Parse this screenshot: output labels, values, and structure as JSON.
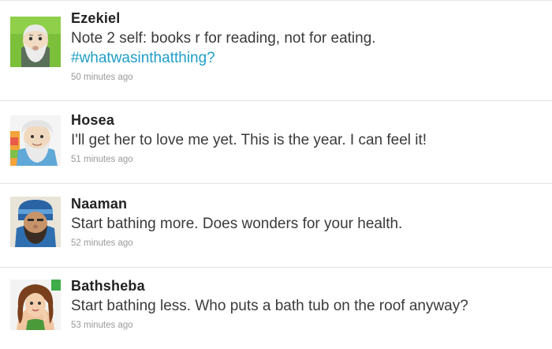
{
  "tweets": [
    {
      "name": "Ezekiel",
      "text": "Note 2 self: books r for reading, not for eating.",
      "hashtag": "#whatwasinthatthing?",
      "time": "50 minutes ago",
      "avatar_icon": "ezekiel-avatar"
    },
    {
      "name": "Hosea",
      "text": "I'll get her to love me yet. This is the year. I can feel it!",
      "time": "51 minutes ago",
      "avatar_icon": "hosea-avatar"
    },
    {
      "name": "Naaman",
      "text": "Start bathing more. Does wonders for your health.",
      "time": "52 minutes ago",
      "avatar_icon": "naaman-avatar"
    },
    {
      "name": "Bathsheba",
      "text": "Start bathing less. Who puts a bath tub on the roof anyway?",
      "time": "53 minutes ago",
      "avatar_icon": "bathsheba-avatar"
    }
  ],
  "colors": {
    "hashtag": "#1f9ec8",
    "name": "#222222",
    "text": "#3a3a3a",
    "timestamp": "#9a9a9a",
    "divider": "#e3e3e3"
  }
}
